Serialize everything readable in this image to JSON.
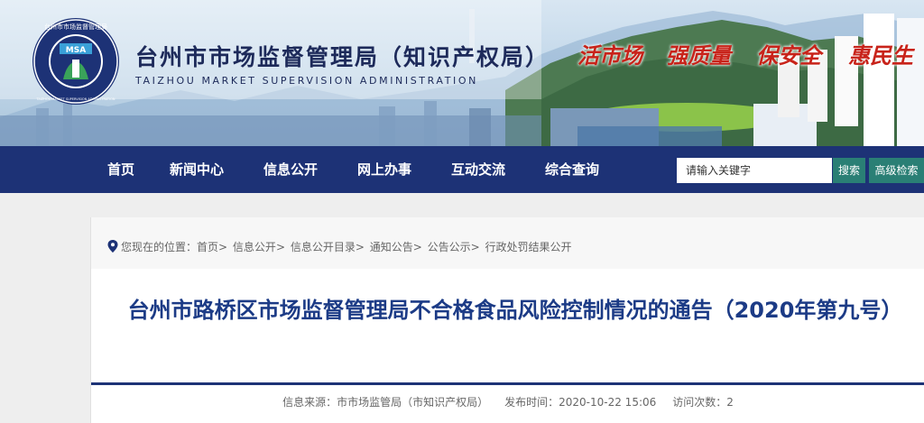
{
  "header": {
    "logo_abbr": "MSA",
    "logo_ring_top": "台州市市场监督管理局",
    "logo_ring_bottom": "TAIZHOU MARKET SUPERVISION ADMINISTRATION",
    "title": "台州市市场监督管理局（知识产权局）",
    "subtitle": "TAIZHOU MARKET SUPERVISION ADMINISTRATION",
    "slogans": [
      "活市场",
      "强质量",
      "保安全",
      "惠民生"
    ],
    "colors": {
      "navy": "#1d3276",
      "slogan_red": "#c8231a",
      "title_blue": "#1c3b86",
      "teal_button": "#2a7f75"
    }
  },
  "nav": {
    "items": [
      "首页",
      "新闻中心",
      "信息公开",
      "网上办事",
      "互动交流",
      "综合查询"
    ],
    "search_placeholder": "请输入关键字",
    "search_label": "搜索",
    "advanced_search_label": "高级检索"
  },
  "breadcrumb": {
    "prefix": "您现在的位置：",
    "items": [
      "首页",
      "信息公开",
      "信息公开目录",
      "通知公告",
      "公告公示",
      "行政处罚结果公开"
    ],
    "separator": ">"
  },
  "article": {
    "title": "台州市路桥区市场监督管理局不合格食品风险控制情况的通告（2020年第九号）",
    "source_label": "信息来源：",
    "source_value": "市市场监管局（市知识产权局）",
    "date_label": "发布时间：",
    "date_value": "2020-10-22 15:06",
    "views_label": "访问次数：",
    "views_value": "2"
  },
  "icons": {
    "breadcrumb": "location-pin-icon",
    "logo": "msa-emblem-icon"
  }
}
